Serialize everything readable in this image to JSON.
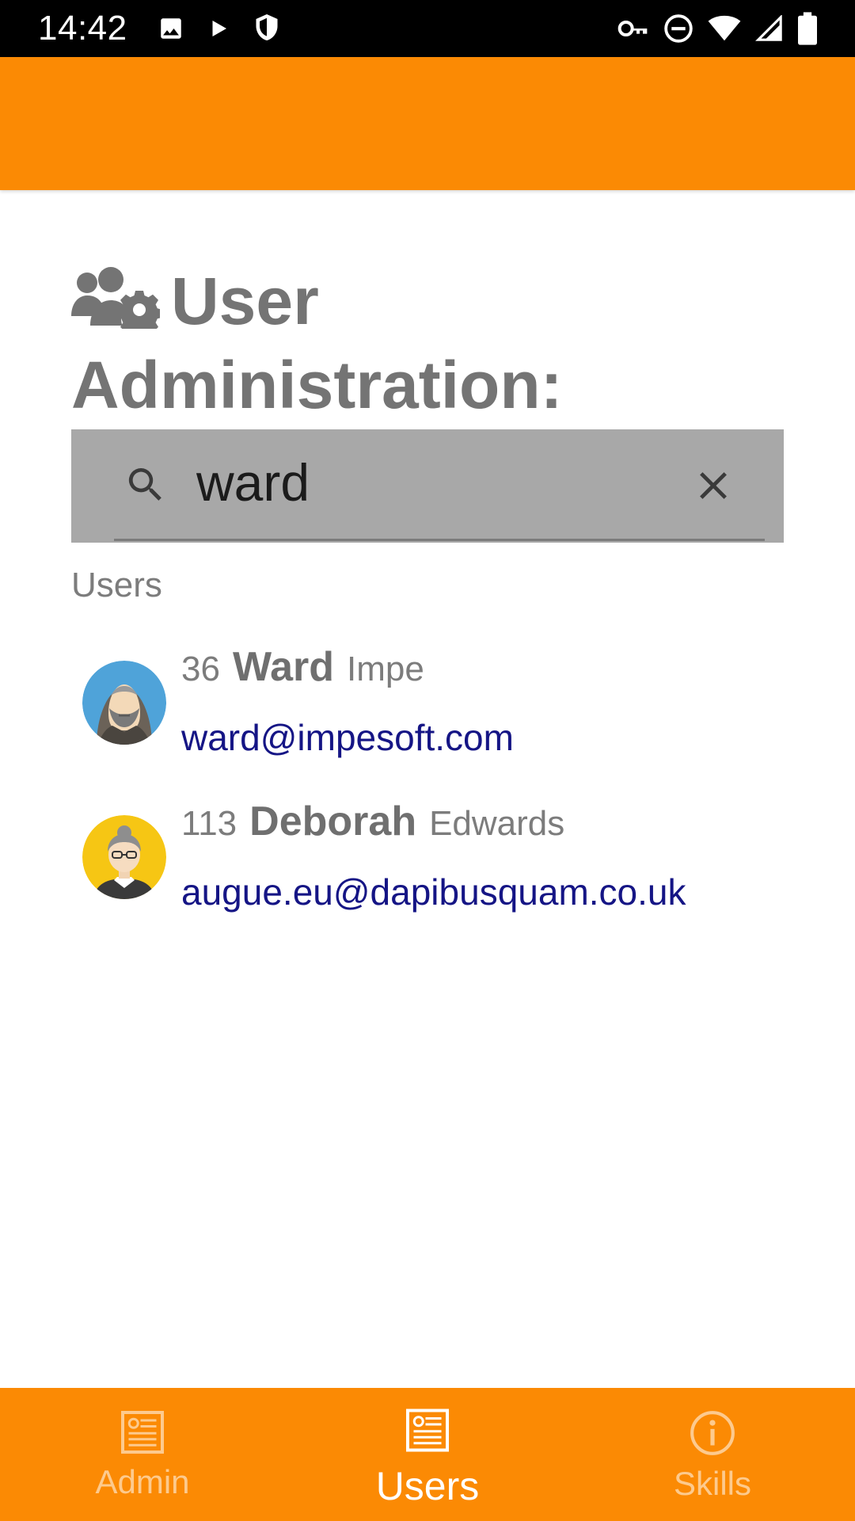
{
  "status_bar": {
    "time": "14:42",
    "left_icons": [
      "image-icon",
      "play-icon",
      "shield-icon"
    ],
    "right_icons": [
      "key-icon",
      "do-not-disturb-icon",
      "wifi-icon",
      "signal-icon",
      "battery-icon"
    ]
  },
  "app_bar": {
    "color": "#FB8A04"
  },
  "header": {
    "icon": "users-gear-icon",
    "title": "User Administration:"
  },
  "search": {
    "value": "ward",
    "placeholder": ""
  },
  "users_section": {
    "label": "Users",
    "items": [
      {
        "id": "36",
        "first_name": "Ward",
        "last_name": "Impe",
        "email": "ward@impesoft.com",
        "avatar": "hooded-man-avatar"
      },
      {
        "id": "113",
        "first_name": "Deborah",
        "last_name": "Edwards",
        "email": "augue.eu@dapibusquam.co.uk",
        "avatar": "grandmother-avatar"
      }
    ]
  },
  "bottom_nav": {
    "items": [
      {
        "label": "Admin",
        "icon": "document-icon",
        "active": false
      },
      {
        "label": "Users",
        "icon": "document-icon",
        "active": true
      },
      {
        "label": "Skills",
        "icon": "info-icon",
        "active": false
      }
    ]
  },
  "colors": {
    "accent": "#FB8A04",
    "email_link": "#151585",
    "search_bg": "#A8A8A8",
    "heading_text": "#747474"
  }
}
